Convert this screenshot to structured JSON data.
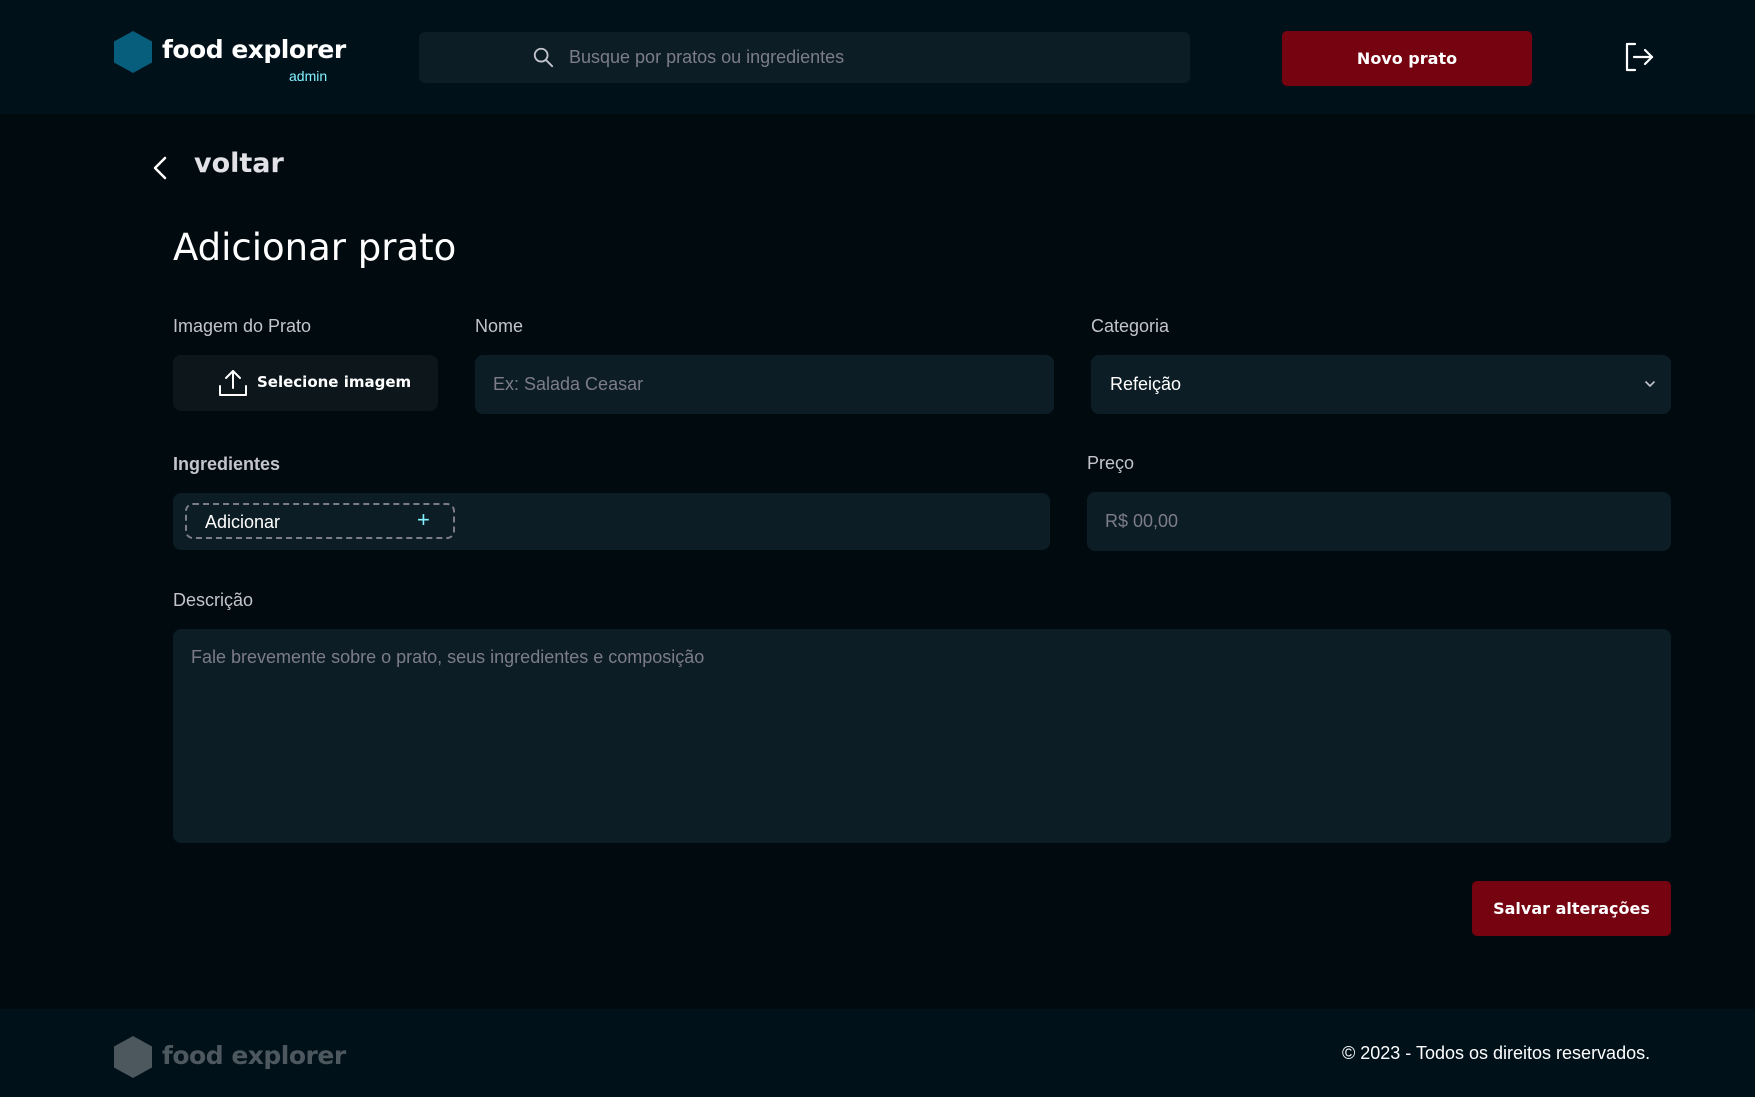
{
  "header": {
    "brand": "food explorer",
    "role_badge": "admin",
    "search_placeholder": "Busque por pratos ou ingredientes",
    "new_dish_label": "Novo prato"
  },
  "back_label": "voltar",
  "page_title": "Adicionar prato",
  "form": {
    "image_label": "Imagem do Prato",
    "image_button": "Selecione imagem",
    "name_label": "Nome",
    "name_placeholder": "Ex: Salada Ceasar",
    "category_label": "Categoria",
    "category_value": "Refeição",
    "ingredients_label": "Ingredientes",
    "ingredient_add_label": "Adicionar",
    "price_label": "Preço",
    "price_placeholder": "R$ 00,00",
    "description_label": "Descrição",
    "description_placeholder": "Fale brevemente sobre o prato, seus ingredientes e composição",
    "save_label": "Salvar alterações"
  },
  "footer": {
    "brand": "food explorer",
    "copyright": "© 2023 - Todos os direitos reservados."
  },
  "colors": {
    "accent": "#750310",
    "brand_hex": "#065E7C",
    "cyan": "#82F3FF",
    "background": "#000A0F",
    "header": "#00111A",
    "input": "#0D1D25"
  },
  "icons": [
    "hexagon-logo-icon",
    "search-icon",
    "logout-icon",
    "chevron-left-icon",
    "upload-icon",
    "chevron-down-icon",
    "plus-icon"
  ]
}
